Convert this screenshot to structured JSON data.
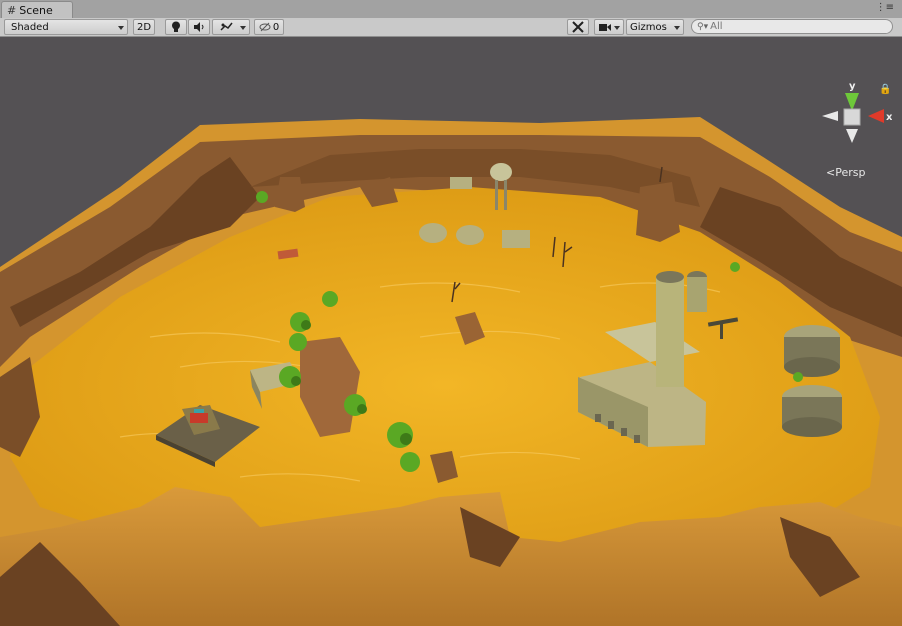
{
  "window": {
    "tab_title": "Scene",
    "tab_icon": "grid-icon",
    "menu_glyph": "⋮≡"
  },
  "toolbar": {
    "draw_mode": "Shaded",
    "mode_2d": "2D",
    "lighting_icon": "light-bulb-icon",
    "audio_icon": "speaker-icon",
    "effects_icon": "effects-icon",
    "hidden_icon": "eye-hidden-icon",
    "hidden_count": "0",
    "tools_icon": "tools-icon",
    "camera_icon": "camera-icon",
    "gizmos_label": "Gizmos",
    "search_placeholder": "All"
  },
  "view_gizmo": {
    "axis_y": "y",
    "axis_x": "x",
    "projection_label": "Persp",
    "lock_icon": "lock-icon"
  },
  "colors": {
    "sky": "#545154",
    "sand": "#e8a820",
    "rock": "#9a6a3a",
    "building": "#b8b47a",
    "palm": "#5aa824"
  }
}
